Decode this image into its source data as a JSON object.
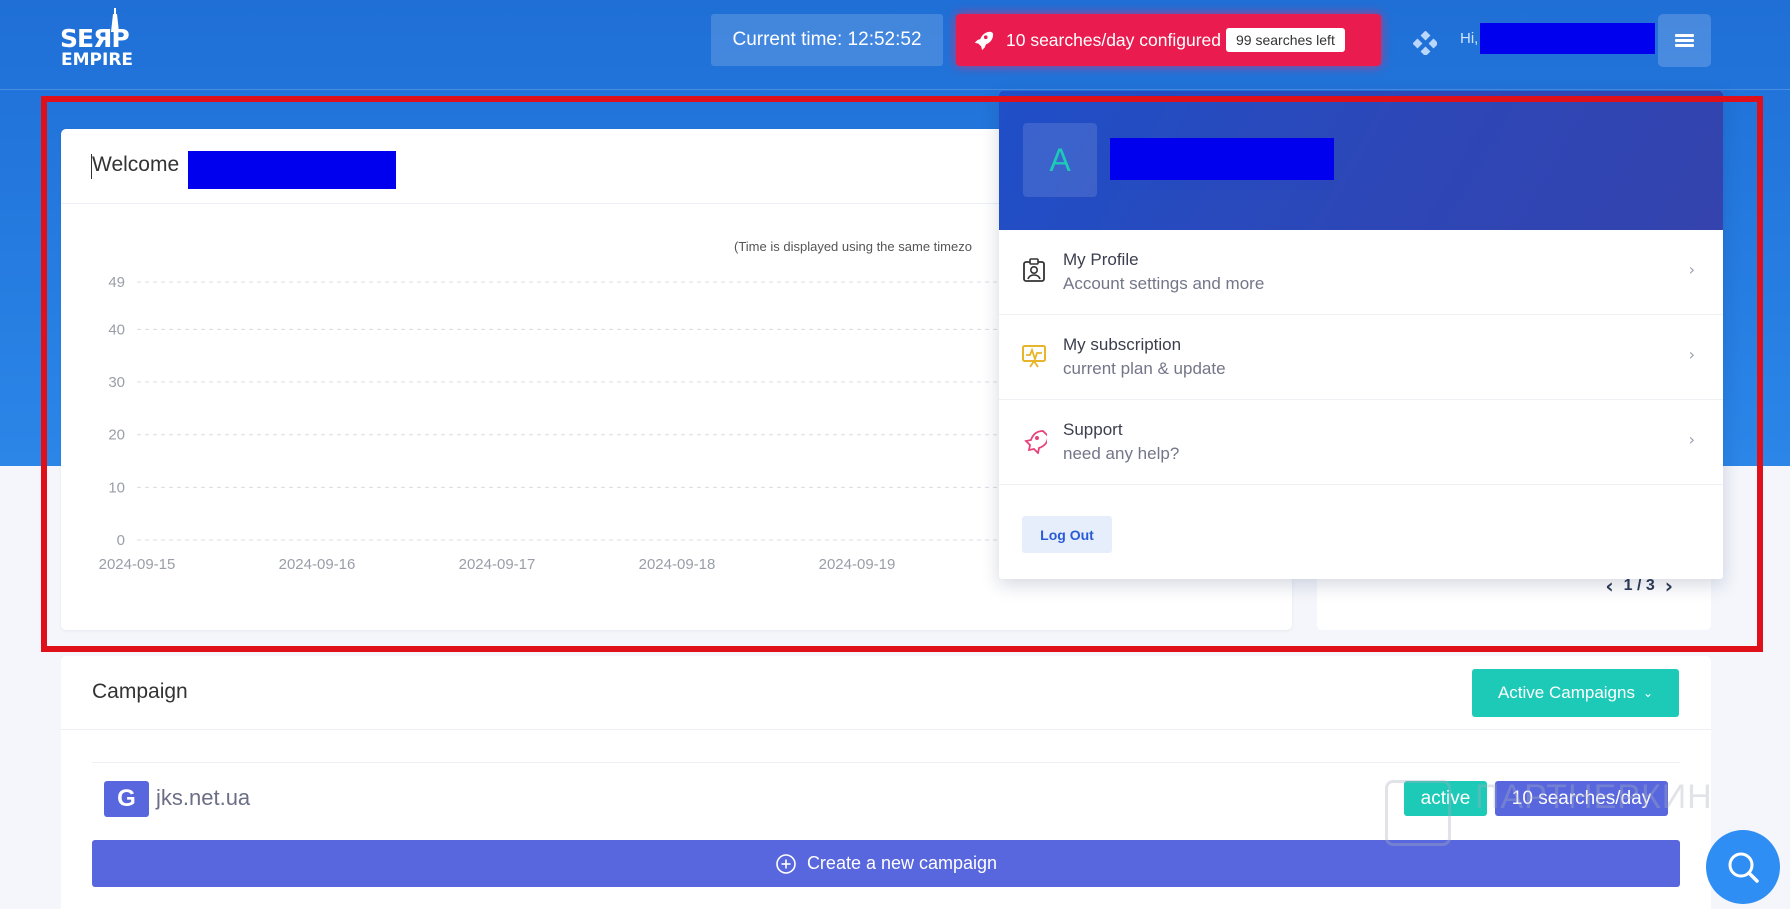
{
  "header": {
    "logo": {
      "line1": "SEЯP",
      "line2": "EMPIRE"
    },
    "current_time": "Current time: 12:52:52",
    "quota": {
      "configured": "10 searches/day configured",
      "left_badge": "99 searches left"
    },
    "greeting": "Hi,"
  },
  "welcome": {
    "title": "Welcome",
    "tz_note": "(Time is displayed using the same timezo"
  },
  "chart_data": {
    "type": "line",
    "x": [
      "2024-09-15",
      "2024-09-16",
      "2024-09-17",
      "2024-09-18",
      "2024-09-19"
    ],
    "y_ticks": [
      0,
      10,
      20,
      30,
      40,
      49
    ],
    "ylim": [
      0,
      49
    ],
    "grid": true,
    "series": []
  },
  "pager": {
    "text": "1 / 3"
  },
  "dropdown": {
    "avatar_letter": "A",
    "items": [
      {
        "title": "My Profile",
        "subtitle": "Account settings and more",
        "icon": "profile-icon"
      },
      {
        "title": "My subscription",
        "subtitle": "current plan & update",
        "icon": "subscription-icon"
      },
      {
        "title": "Support",
        "subtitle": "need any help?",
        "icon": "support-icon"
      }
    ],
    "logout": "Log Out"
  },
  "campaign": {
    "title": "Campaign",
    "filter_button": "Active Campaigns",
    "rows": [
      {
        "engine": "G",
        "domain": "jks.net.ua",
        "status": "active",
        "quota": "10 searches/day"
      }
    ],
    "create_button": "Create a new campaign"
  },
  "watermark": "ПАРТНЕРКИН",
  "colors": {
    "brand_blue": "#2b86e8",
    "quota_red": "#ea1c4f",
    "teal": "#1dc9b7",
    "indigo": "#5867dd",
    "highlight_red": "#e0101a"
  }
}
